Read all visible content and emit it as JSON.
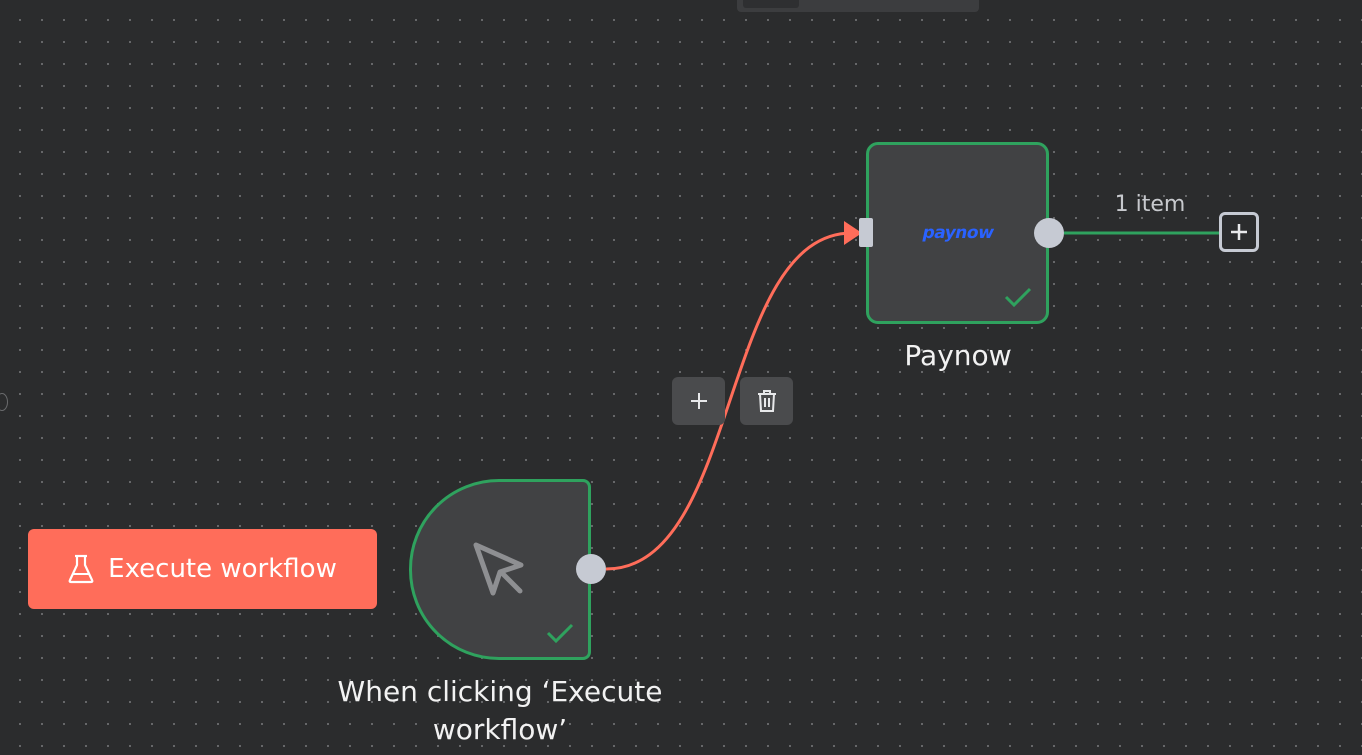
{
  "workflow": {
    "nodes": {
      "trigger": {
        "label": "When clicking ‘Execute workflow’",
        "icon": "cursor-icon",
        "status": "success"
      },
      "paynow": {
        "label": "Paynow",
        "logo_text": "paynow",
        "icon": "paynow-logo",
        "status": "success"
      }
    },
    "connections": [
      {
        "from": "trigger",
        "to": "paynow",
        "color": "#ff6d5a"
      },
      {
        "from": "paynow",
        "to": "add-node",
        "label": "1 item",
        "color": "#2fa25e"
      }
    ]
  },
  "toolbar": {
    "execute_label": "Execute workflow",
    "execute_icon": "flask-icon"
  },
  "edge_toolbar": {
    "add_icon": "plus-icon",
    "delete_icon": "trash-icon"
  },
  "colors": {
    "canvas_bg": "#2b2c2d",
    "node_bg": "#414244",
    "success": "#2fa25e",
    "accent": "#ff6d5a",
    "handle": "#c6cad3",
    "paynow_brand": "#2a62ff"
  }
}
